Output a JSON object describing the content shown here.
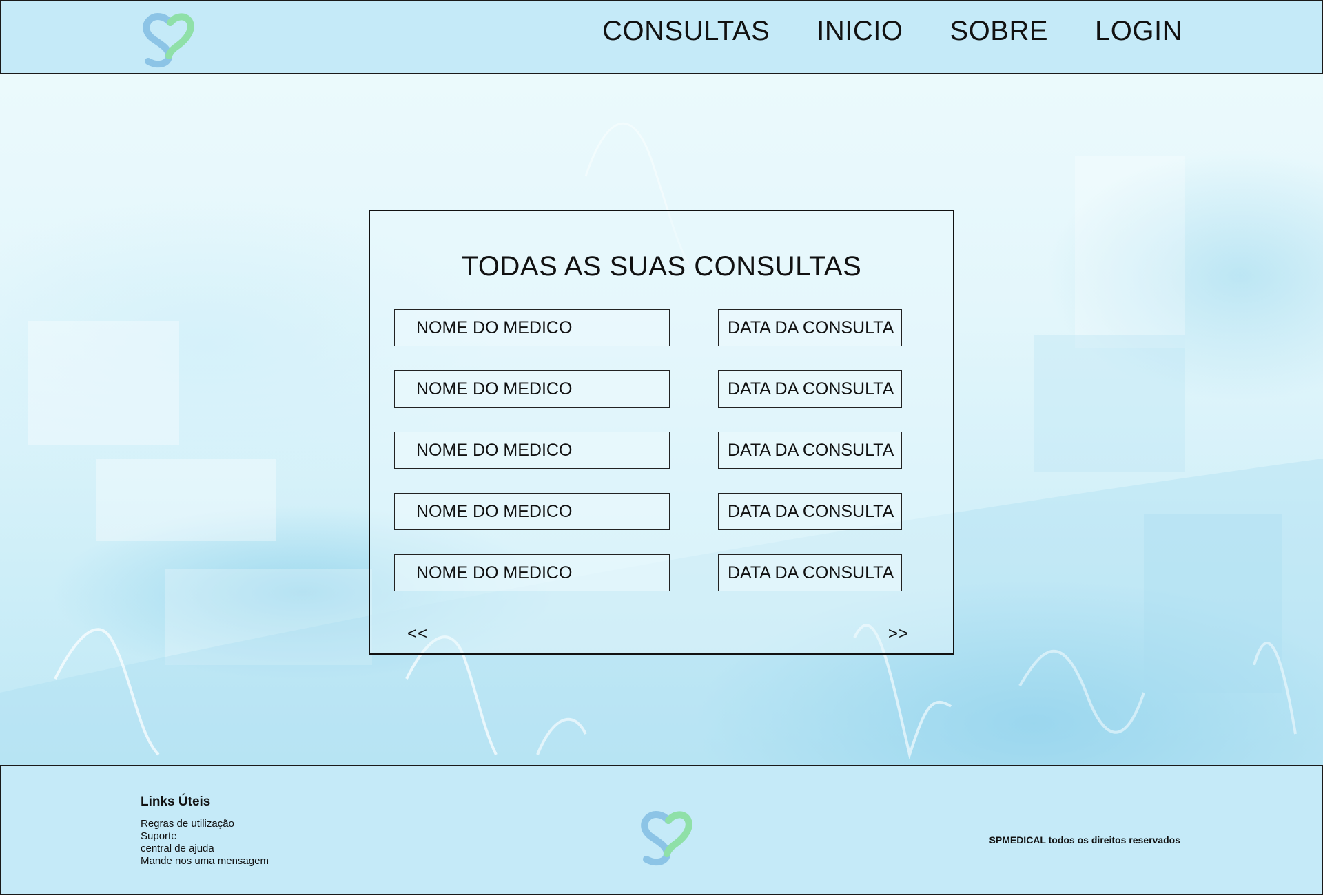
{
  "header": {
    "nav": [
      {
        "label": "CONSULTAS"
      },
      {
        "label": "INICIO"
      },
      {
        "label": "SOBRE"
      },
      {
        "label": "LOGIN"
      }
    ]
  },
  "main": {
    "title": "TODAS AS SUAS CONSULTAS",
    "rows": [
      {
        "medico": "NOME DO MEDICO",
        "data": "DATA DA CONSULTA"
      },
      {
        "medico": "NOME DO MEDICO",
        "data": "DATA DA CONSULTA"
      },
      {
        "medico": "NOME DO MEDICO",
        "data": "DATA DA CONSULTA"
      },
      {
        "medico": "NOME DO MEDICO",
        "data": "DATA DA CONSULTA"
      },
      {
        "medico": "NOME DO MEDICO",
        "data": "DATA DA CONSULTA"
      }
    ],
    "pager": {
      "prev": "<<",
      "next": ">>"
    }
  },
  "footer": {
    "links_title": "Links Úteis",
    "links": [
      "Regras de utilização",
      "Suporte",
      "central de ajuda",
      "Mande nos uma mensagem"
    ],
    "copyright": "SPMEDICAL todos os direitos reservados"
  },
  "colors": {
    "bar_background": "#c5eaf8",
    "logo_blue": "#8cc4e6",
    "logo_green": "#8fe0a8",
    "text": "#111111"
  },
  "icons": {
    "logo": "heart-s-logo-icon",
    "background": "ecg-wave-decoration"
  }
}
